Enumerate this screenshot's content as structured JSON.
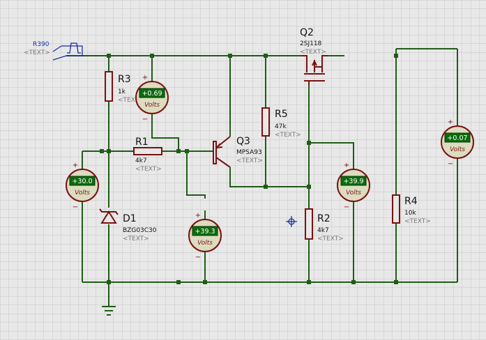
{
  "source": {
    "name": "R390",
    "text": "<TEXT>"
  },
  "components": {
    "r3": {
      "ref": "R3",
      "value": "1k",
      "text": "<TEXT>"
    },
    "r1": {
      "ref": "R1",
      "value": "4k7",
      "text": "<TEXT>"
    },
    "r5": {
      "ref": "R5",
      "value": "47k",
      "text": "<TEXT>"
    },
    "r2": {
      "ref": "R2",
      "value": "4k7",
      "text": "<TEXT>"
    },
    "r4": {
      "ref": "R4",
      "value": "10k",
      "text": "<TEXT>"
    },
    "q2": {
      "ref": "Q2",
      "value": "2SJ118",
      "text": "<TEXT>"
    },
    "q3": {
      "ref": "Q3",
      "value": "MPSA93",
      "text": "<TEXT>"
    },
    "d1": {
      "ref": "D1",
      "value": "BZG03C30",
      "text": "<TEXT>"
    }
  },
  "voltmeters": {
    "vm1": {
      "reading": "+0.69",
      "unit": "Volts"
    },
    "vm2": {
      "reading": "+30.0",
      "unit": "Volts"
    },
    "vm3": {
      "reading": "+39.3",
      "unit": "Volts"
    },
    "vm4": {
      "reading": "+39.9",
      "unit": "Volts"
    },
    "vm5": {
      "reading": "+0.07",
      "unit": "Volts"
    }
  },
  "terminal_signs": {
    "plus": "+",
    "minus": "−"
  },
  "colors": {
    "background": "#e8e8e8",
    "grid": "#c6c6c6",
    "wire": "#1f5c16",
    "component": "#7a1010",
    "meter_body": "#dcdcc0",
    "display": "#0d6a0d",
    "source": "#1a2fa0"
  }
}
